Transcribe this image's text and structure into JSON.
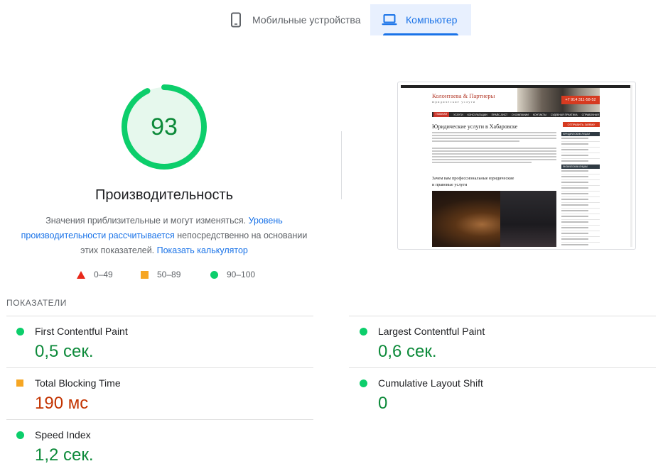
{
  "tabs": {
    "mobile_label": "Мобильные устройства",
    "desktop_label": "Компьютер"
  },
  "gauge": {
    "score": "93",
    "score_fraction": 0.93,
    "title": "Производительность",
    "desc_part1": "Значения приблизительные и могут изменяться. ",
    "desc_link1": "Уровень производительности рассчитывается",
    "desc_part2": " непосредственно на основании этих показателей. ",
    "desc_link2": "Показать калькулятор",
    "color_good": "#0cce6b"
  },
  "legend": {
    "fail": "0–49",
    "average": "50–89",
    "pass": "90–100"
  },
  "screenshot": {
    "logo": "Колонтаева & Партнеры",
    "logo_sub": "юридические услуги",
    "phone": "+7 914 311-58-52",
    "nav": [
      "ГЛАВНАЯ",
      "УСЛУГИ",
      "КОНСУЛЬТАЦИИ",
      "ПРАЙС-ЛИСТ",
      "О КОМПАНИИ",
      "КОНТАКТЫ",
      "СУДЕБНАЯ ПРАКТИКА",
      "СПРАВОЧНАЯ"
    ],
    "call_button": "ОТПРАВИТЬ ЗАЯВКУ",
    "heading": "Юридические услуги в Хабаровске",
    "subheading1": "Зачем вам профессиональные юридические",
    "subheading2": "и правовые услуги",
    "side_heading1": "ЮРИДИЧЕСКИМ ЛИЦАМ",
    "side_heading2": "ФИЗИЧЕСКИМ ЛИЦАМ"
  },
  "metrics": {
    "section_title": "ПОКАЗАТЕЛИ",
    "fcp_label": "First Contentful Paint",
    "fcp_value": "0,5 сек.",
    "lcp_label": "Largest Contentful Paint",
    "lcp_value": "0,6 сек.",
    "tbt_label": "Total Blocking Time",
    "tbt_value": "190 мс",
    "cls_label": "Cumulative Layout Shift",
    "cls_value": "0",
    "si_label": "Speed Index",
    "si_value": "1,2 сек."
  }
}
